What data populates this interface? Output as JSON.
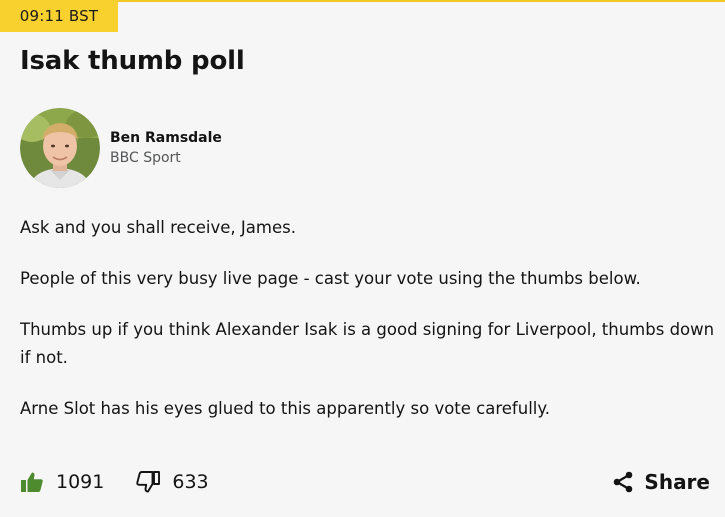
{
  "post": {
    "timestamp": "09:11 BST",
    "headline": "Isak thumb poll",
    "author": {
      "name": "Ben Ramsdale",
      "organisation": "BBC Sport"
    },
    "paragraphs": [
      "Ask and you shall receive, James.",
      "People of this very busy live page - cast your vote using the thumbs below.",
      "Thumbs up if you think Alexander Isak is a good signing for Liverpool, thumbs down if not.",
      "Arne Slot has his eyes glued to this apparently so vote carefully."
    ]
  },
  "reactions": {
    "thumbs_up": {
      "icon": "thumbs-up-icon",
      "count": "1091"
    },
    "thumbs_down": {
      "icon": "thumbs-down-icon",
      "count": "633"
    }
  },
  "share": {
    "icon": "share-icon",
    "label": "Share"
  },
  "colors": {
    "timestamp_bg": "#f8d12f",
    "accent_line": "#f5c727",
    "thumbs_up": "#4e8a2e",
    "text": "#141414",
    "muted": "#545658",
    "background": "#f6f6f6"
  }
}
